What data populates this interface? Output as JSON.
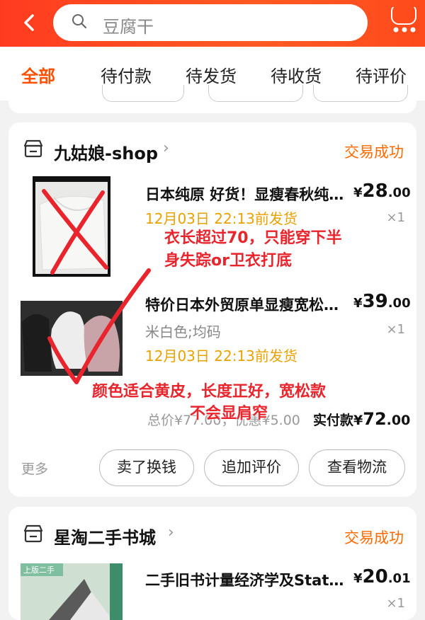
{
  "header": {
    "search_placeholder": "豆腐干"
  },
  "tabs": [
    {
      "label": "全部",
      "active": true
    },
    {
      "label": "待付款"
    },
    {
      "label": "待发货"
    },
    {
      "label": "待收货"
    },
    {
      "label": "待评价"
    }
  ],
  "orders": [
    {
      "shop": "九姑娘-shop",
      "status": "交易成功",
      "items": [
        {
          "title": "日本纯原 好货！显瘦春秋纯…",
          "price_symbol": "¥",
          "price_int": "28",
          "price_dec": ".00",
          "qty": "×1",
          "ship": "12月03日 22:13前发货"
        },
        {
          "title": "特价日本外贸原单显瘦宽松…",
          "price_symbol": "¥",
          "price_int": "39",
          "price_dec": ".00",
          "qty": "×1",
          "spec": "米白色;均码",
          "ship": "12月03日 22:13前发货"
        }
      ],
      "total_label": "总价¥77.00，优惠¥5.00",
      "paid_label": "实付款",
      "paid_symbol": "¥",
      "paid_int": "72",
      "paid_dec": ".00",
      "more": "更多",
      "buttons": [
        "卖了换钱",
        "追加评价",
        "查看物流"
      ]
    },
    {
      "shop": "星淘二手书城",
      "status": "交易成功",
      "items": [
        {
          "title": "二手旧书计量经济学及Stat…",
          "price_symbol": "¥",
          "price_int": "20",
          "price_dec": ".01",
          "qty": "×1",
          "thumb_label": "上版二手"
        }
      ]
    }
  ],
  "annotations": {
    "note1_line1": "衣长超过70，只能穿下半",
    "note1_line2": "身失踪or卫衣打底",
    "note2_line1": "颜色适合黄皮，长度正好，宽松款",
    "note2_line2": "不会显肩窄"
  },
  "colors": {
    "brand": "#ff5000",
    "status": "#ff6a00",
    "ship": "#e8a200",
    "annotation": "#e8242d"
  }
}
